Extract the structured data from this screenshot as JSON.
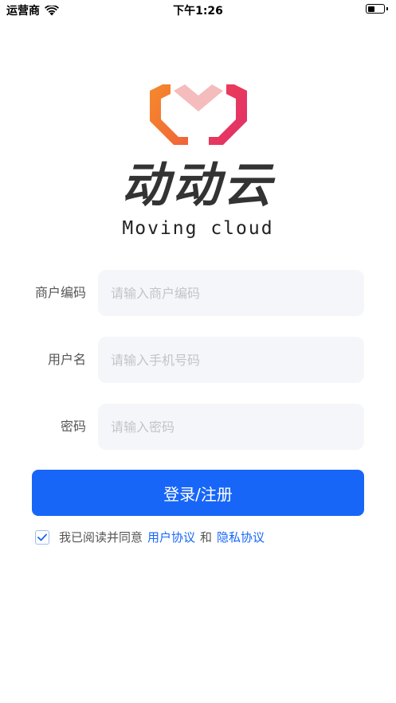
{
  "status_bar": {
    "carrier": "运营商",
    "time": "下午1:26",
    "icons": [
      "wifi-icon",
      "battery-icon"
    ]
  },
  "logo": {
    "title": "动动云",
    "subtitle": "Moving cloud",
    "colors": {
      "orange": "#f47a2b",
      "pink": "#f3b7b8",
      "red": "#e8344e"
    }
  },
  "form": {
    "merchant_code": {
      "label": "商户编码",
      "placeholder": "请输入商户编码",
      "value": ""
    },
    "username": {
      "label": "用户名",
      "placeholder": "请输入手机号码",
      "value": ""
    },
    "password": {
      "label": "密码",
      "placeholder": "请输入密码",
      "value": ""
    },
    "submit_label": "登录/注册"
  },
  "agreement": {
    "checked": true,
    "prefix": "我已阅读并同意",
    "user_agreement": "用户协议",
    "conjunction": "和",
    "privacy_policy": "隐私协议"
  },
  "colors": {
    "primary": "#1766f8",
    "input_bg": "#f5f6fa",
    "label": "#555555",
    "placeholder": "#c4c4c8"
  }
}
